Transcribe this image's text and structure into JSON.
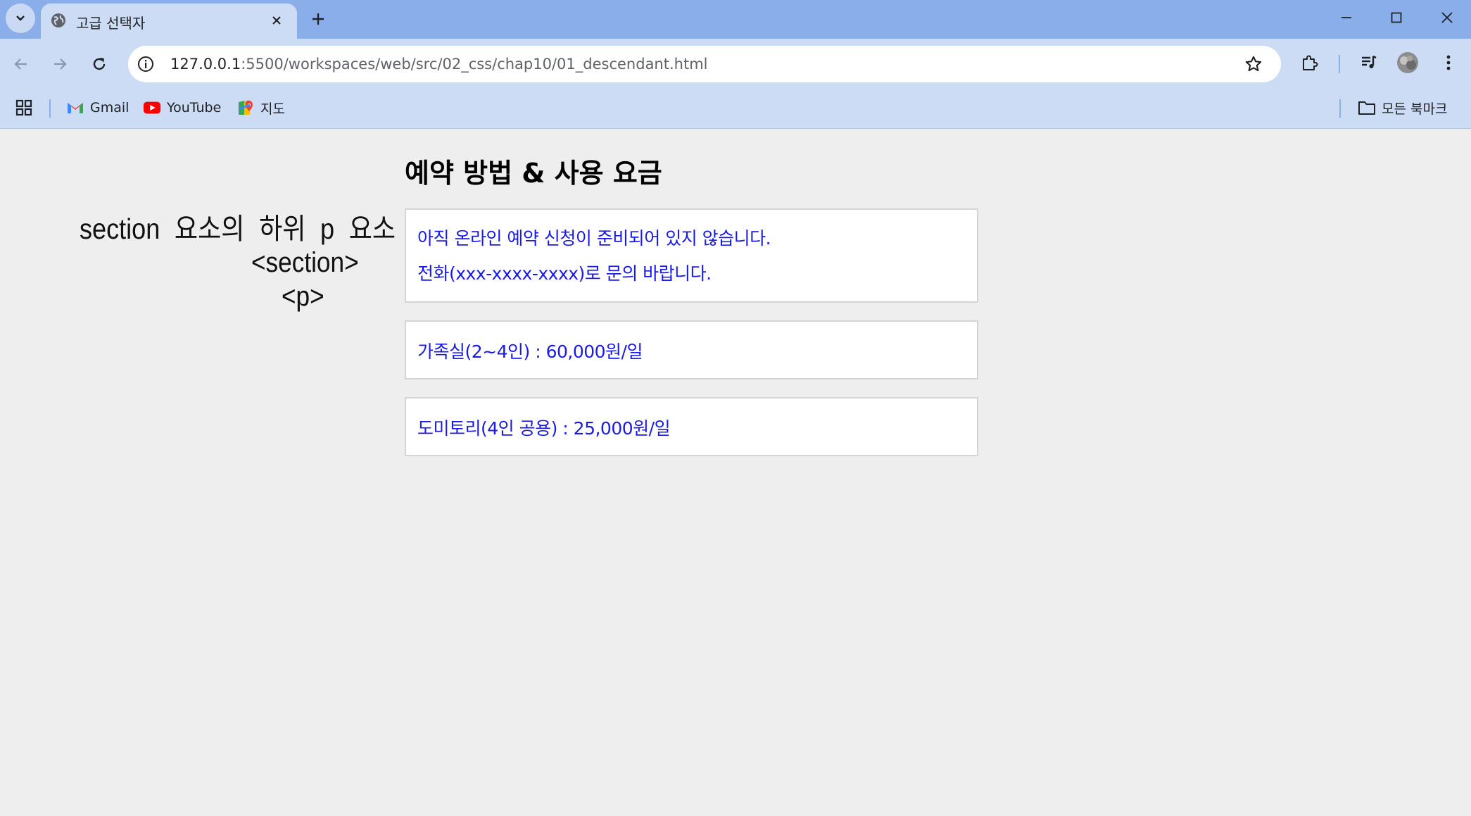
{
  "browser": {
    "tab": {
      "title": "고급 선택자"
    },
    "address": {
      "host": "127.0.0.1",
      "path": ":5500/workspaces/web/src/02_css/chap10/01_descendant.html"
    },
    "bookmarks": [
      {
        "label": "Gmail",
        "icon": "gmail-icon"
      },
      {
        "label": "YouTube",
        "icon": "youtube-icon"
      },
      {
        "label": "지도",
        "icon": "maps-icon"
      }
    ],
    "all_bookmarks_label": "모든 북마크"
  },
  "annotation": {
    "line1": "section 요소의 하위 p 요소",
    "line2": "<section>",
    "line3": "<p>"
  },
  "content": {
    "heading": "예약 방법 & 사용 요금",
    "sections": [
      {
        "paragraphs": [
          "아직 온라인 예약 신청이 준비되어 있지 않습니다.",
          "전화(xxx-xxxx-xxxx)로 문의 바랍니다."
        ]
      },
      {
        "paragraphs": [
          "가족실(2~4인) : 60,000원/일"
        ]
      },
      {
        "paragraphs": [
          "도미토리(4인 공용) : 25,000원/일"
        ]
      }
    ]
  },
  "colors": {
    "paragraph_text": "#1a1ae6",
    "page_background": "#eeeeee",
    "tabstrip": "#8aaeea",
    "toolbar": "#cddcf5"
  }
}
